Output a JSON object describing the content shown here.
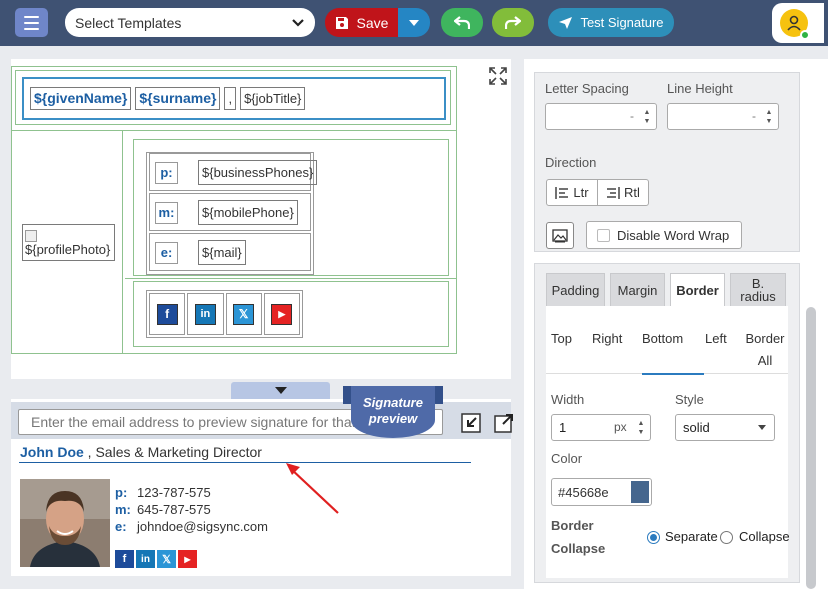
{
  "toolbar": {
    "template_select": "Select Templates",
    "save_label": "Save",
    "test_label": "Test Signature"
  },
  "editor": {
    "given_name": "${givenName}",
    "surname": "${surname}",
    "comma": ",",
    "job_title": "${jobTitle}",
    "profile_photo": "${profilePhoto}",
    "contacts": [
      {
        "label": "p:",
        "value": "${businessPhones}"
      },
      {
        "label": "m:",
        "value": "${mobilePhone}"
      },
      {
        "label": "e:",
        "value": "${mail}"
      }
    ],
    "social": [
      {
        "icon": "facebook-icon",
        "glyph": "f",
        "color": "#1d4b9a"
      },
      {
        "icon": "linkedin-icon",
        "glyph": "in",
        "color": "#1577b6"
      },
      {
        "icon": "x-icon",
        "glyph": "𝕏",
        "color": "#2b95d6"
      },
      {
        "icon": "youtube-icon",
        "glyph": "▶",
        "color": "#e52323"
      }
    ]
  },
  "preview": {
    "email_placeholder": "Enter the email address to preview signature for that user",
    "ribbon_line1": "Signature",
    "ribbon_line2": "preview",
    "name": "John Doe",
    "title_sep": " , ",
    "job_title": "Sales & Marketing Director",
    "contacts": [
      {
        "label": "p:",
        "value": "123-787-575"
      },
      {
        "label": "m:",
        "value": "645-787-575"
      },
      {
        "label": "e:",
        "value": "johndoe@sigsync.com"
      }
    ]
  },
  "properties": {
    "letter_spacing_label": "Letter Spacing",
    "letter_spacing_value": "-",
    "line_height_label": "Line Height",
    "line_height_value": "-",
    "direction_label": "Direction",
    "dir_ltr": "Ltr",
    "dir_rtl": "Rtl",
    "disable_wrap": "Disable Word Wrap",
    "tabs": [
      "Padding",
      "Margin",
      "Border",
      "B. radius"
    ],
    "border_sides": [
      "Top",
      "Right",
      "Bottom",
      "Left",
      "Border All"
    ],
    "width_label": "Width",
    "width_value": "1",
    "width_unit": "px",
    "style_label": "Style",
    "style_value": "solid",
    "color_label": "Color",
    "color_value": "#45668e",
    "collapse_label_1": "Border",
    "collapse_label_2": "Collapse",
    "separate": "Separate",
    "collapse": "Collapse"
  },
  "colors": {
    "topbar": "#3f5273",
    "save": "#c0141a",
    "accent": "#1d5fa3",
    "border_color": "#45668e"
  }
}
